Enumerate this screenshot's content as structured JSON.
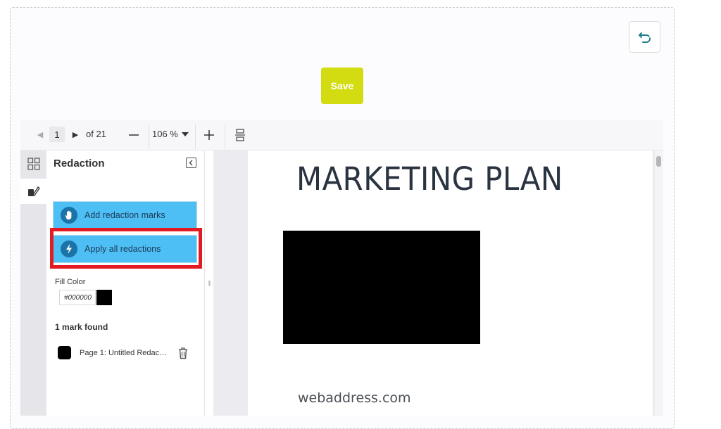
{
  "header": {
    "save_label": "Save",
    "undo_icon": "undo-icon"
  },
  "toolbar": {
    "current_page": "1",
    "page_total": "of 21",
    "zoom": "106 %"
  },
  "rail": {
    "tabs": [
      "thumbnails-icon",
      "redaction-pen-icon"
    ]
  },
  "panel": {
    "title": "Redaction",
    "add_marks_label": "Add redaction marks",
    "apply_all_label": "Apply all redactions",
    "fill_color_label": "Fill Color",
    "fill_color_value": "#000000",
    "marks_found": "1 mark found",
    "marks": [
      {
        "label": "Page 1: Untitled Redaction",
        "color": "#000000"
      }
    ]
  },
  "document": {
    "title": "MARKETING PLAN",
    "url": "webaddress.com"
  },
  "colors": {
    "save_bg": "#d2dc10",
    "action_bg": "#4dbff5",
    "highlight": "#e21b23",
    "undo_icon": "#1a7f8a"
  }
}
